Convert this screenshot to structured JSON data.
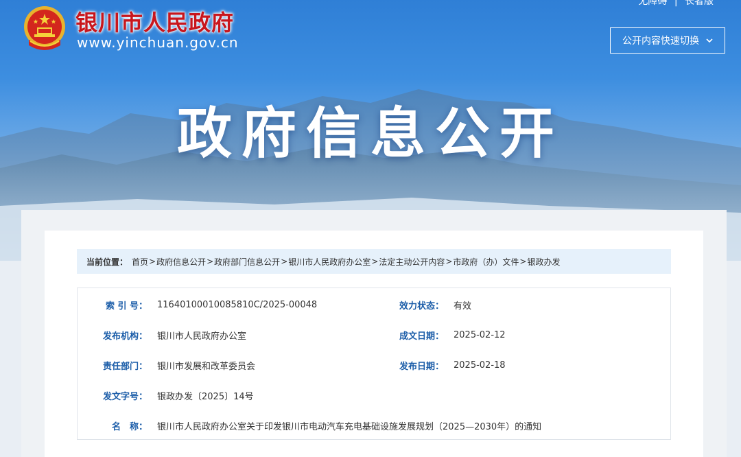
{
  "header": {
    "site_name": "银川市人民政府",
    "site_url": "www.yinchuan.gov.cn",
    "top_links": [
      "无障碍",
      "长者版"
    ],
    "switch_label": "公开内容快速切换",
    "hero_title": "政府信息公开"
  },
  "breadcrumb": {
    "label": "当前位置：",
    "items": [
      "首页",
      "政府信息公开",
      "政府部门信息公开",
      "银川市人民政府办公室",
      "法定主动公开内容",
      "市政府（办）文件",
      "银政办发"
    ],
    "separator": ">"
  },
  "info": {
    "index_no": {
      "label": "索 引 号：",
      "value": "11640100010085810C/2025-00048"
    },
    "status": {
      "label": "效力状态：",
      "value": "有效"
    },
    "publisher": {
      "label": "发布机构：",
      "value": "银川市人民政府办公室"
    },
    "date_written": {
      "label": "成文日期：",
      "value": "2025-02-12"
    },
    "department": {
      "label": "责任部门：",
      "value": "银川市发展和改革委员会"
    },
    "date_published": {
      "label": "发布日期：",
      "value": "2025-02-18"
    },
    "doc_no": {
      "label": "发文字号：",
      "value": "银政办发〔2025〕14号"
    },
    "title": {
      "label": "名　称：",
      "value": "银川市人民政府办公室关于印发银川市电动汽车充电基础设施发展规划（2025—2030年）的通知"
    }
  },
  "colors": {
    "brand_red": "#c8161d",
    "label_blue": "#1a5ca8",
    "sky_blue": "#2f7fd6",
    "breadcrumb_bg": "#e6f1fb"
  }
}
